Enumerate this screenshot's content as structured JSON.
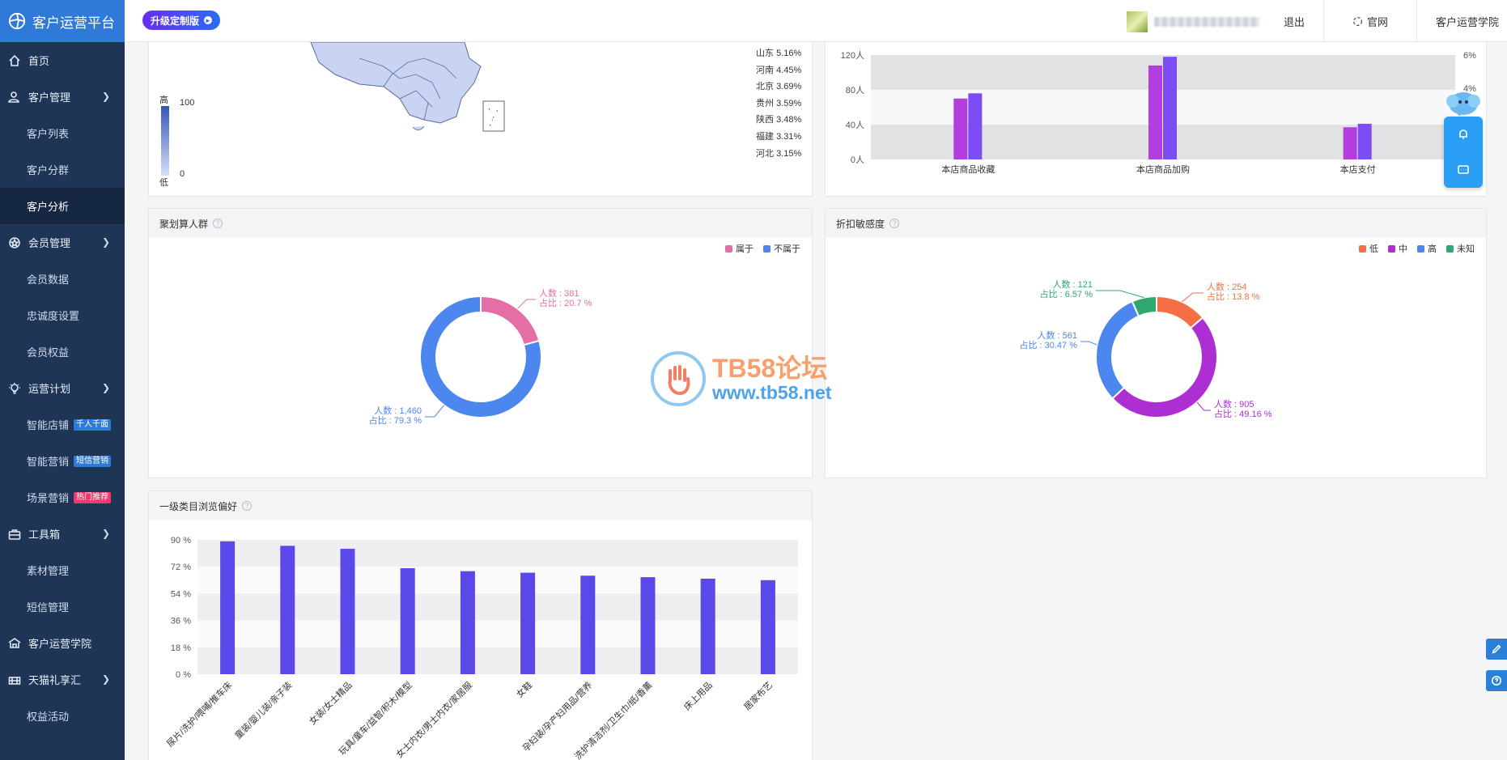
{
  "app": {
    "title": "客户运营平台"
  },
  "sidebar": {
    "items": [
      {
        "label": "首页",
        "icon": "home-icon"
      },
      {
        "label": "客户管理",
        "icon": "user-icon",
        "children": [
          "客户列表",
          "客户分群",
          "客户分析"
        ]
      },
      {
        "label": "会员管理",
        "icon": "badge-icon",
        "children": [
          "会员数据",
          "忠诚度设置",
          "会员权益"
        ]
      },
      {
        "label": "运营计划",
        "icon": "bulb-icon",
        "children": [
          "智能店铺",
          "智能营销",
          "场景营销"
        ]
      },
      {
        "label": "工具箱",
        "icon": "toolbox-icon",
        "children": [
          "素材管理",
          "短信管理"
        ]
      },
      {
        "label": "客户运营学院",
        "icon": "academy-icon"
      },
      {
        "label": "天猫礼享汇",
        "icon": "gift-icon",
        "children": [
          "权益活动"
        ]
      }
    ],
    "active": "客户分析",
    "tags": {
      "smart_store": "千人千面",
      "smart_marketing": "短信营销",
      "scene_marketing": "热门推荐"
    }
  },
  "topbar": {
    "upgrade_label": "升级定制版",
    "logout": "退出",
    "official": "官网",
    "academy": "客户运营学院"
  },
  "map_panel": {
    "legend_high": "高",
    "legend_low": "低",
    "legend_max": "100",
    "legend_min": "0",
    "provinces": [
      {
        "name": "山东",
        "pct": "5.16%"
      },
      {
        "name": "河南",
        "pct": "4.45%"
      },
      {
        "name": "北京",
        "pct": "3.69%"
      },
      {
        "name": "贵州",
        "pct": "3.59%"
      },
      {
        "name": "陕西",
        "pct": "3.48%"
      },
      {
        "name": "福建",
        "pct": "3.31%"
      },
      {
        "name": "河北",
        "pct": "3.15%"
      }
    ]
  },
  "chart_data": [
    {
      "id": "behavior",
      "type": "bar",
      "categories": [
        "本店商品收藏",
        "本店商品加购",
        "本店支付"
      ],
      "series": [
        {
          "values": [
            70,
            108,
            37
          ],
          "color": "#b23ee0"
        },
        {
          "values": [
            76,
            118,
            41
          ],
          "color": "#7b4df2"
        }
      ],
      "yticks": [
        "0人",
        "40人",
        "80人",
        "120人"
      ],
      "ylim": [
        0,
        120
      ],
      "right_ticks": [
        "4%",
        "6%"
      ]
    },
    {
      "id": "juhuasuan",
      "type": "pie",
      "title": "聚划算人群",
      "legend": [
        {
          "name": "属于",
          "color": "#e46fa6"
        },
        {
          "name": "不属于",
          "color": "#4b87ef"
        }
      ],
      "slices": [
        {
          "name": "属于",
          "value": 381,
          "pct": 20.7,
          "color": "#e46fa6",
          "label1": "人数 : 381",
          "label2": "占比 : 20.7 %"
        },
        {
          "name": "不属于",
          "value": 1460,
          "pct": 79.3,
          "color": "#4b87ef",
          "label1": "人数 : 1,460",
          "label2": "占比 : 79.3 %"
        }
      ]
    },
    {
      "id": "discount",
      "type": "pie",
      "title": "折扣敏感度",
      "legend": [
        {
          "name": "低",
          "color": "#f56f46"
        },
        {
          "name": "中",
          "color": "#ad2ed2"
        },
        {
          "name": "高",
          "color": "#4b87ef"
        },
        {
          "name": "未知",
          "color": "#2fa76e"
        }
      ],
      "slices": [
        {
          "name": "低",
          "value": 254,
          "pct": 13.8,
          "color": "#f56f46",
          "label1": "人数 : 254",
          "label2": "占比 : 13.8 %"
        },
        {
          "name": "中",
          "value": 905,
          "pct": 49.16,
          "color": "#ad2ed2",
          "label1": "人数 : 905",
          "label2": "占比 : 49.16 %"
        },
        {
          "name": "高",
          "value": 561,
          "pct": 30.47,
          "color": "#4b87ef",
          "label1": "人数 : 561",
          "label2": "占比 : 30.47 %"
        },
        {
          "name": "未知",
          "value": 121,
          "pct": 6.57,
          "color": "#2fa76e",
          "label1": "人数 : 121",
          "label2": "占比 : 6.57 %"
        }
      ]
    },
    {
      "id": "category",
      "type": "bar",
      "title": "一级类目浏览偏好",
      "categories": [
        "尿片/洗护/喂哺/推车床",
        "童装/婴儿装/亲子装",
        "女装/女士精品",
        "玩具/童车/益智/积木/模型",
        "女士内衣/男士内衣/家居服",
        "女鞋",
        "孕妇装/孕产妇用品/营养",
        "洗护清洁剂/卫生巾/纸/香薰",
        "床上用品",
        "居家布艺"
      ],
      "values": [
        89,
        86,
        84,
        71,
        69,
        68,
        66,
        65,
        64,
        63
      ],
      "yticks": [
        "0 %",
        "18 %",
        "36 %",
        "54 %",
        "72 %",
        "90 %"
      ],
      "ylim": [
        0,
        90
      ],
      "color": "#5a48e8"
    }
  ],
  "watermark": {
    "line1": "TB58论坛",
    "line2": "www.tb58.net"
  }
}
